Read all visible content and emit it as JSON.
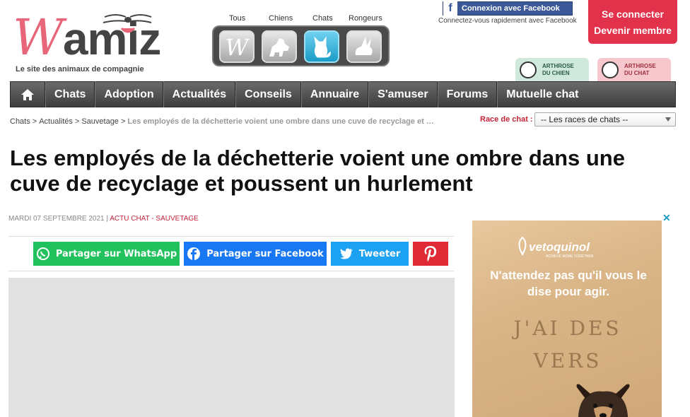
{
  "header": {
    "logo_first": "W",
    "logo_rest": "amiz",
    "tagline": "Le site des animaux de compagnie",
    "species": [
      {
        "label": "Tous",
        "icon": "w-logo-icon"
      },
      {
        "label": "Chiens",
        "icon": "dog-icon"
      },
      {
        "label": "Chats",
        "icon": "cat-icon",
        "active": true
      },
      {
        "label": "Rongeurs",
        "icon": "rabbit-icon"
      }
    ],
    "facebook_connect": "Connexion avec Facebook",
    "facebook_sub": "Connectez-vous rapidement avec Facebook",
    "login": "Se connecter",
    "signup": "Devenir membre",
    "arthrose_dog": [
      "ARTHROSE",
      "DU CHIEN"
    ],
    "arthrose_cat": [
      "ARTHROSE",
      "DU CHAT"
    ]
  },
  "nav": {
    "items": [
      "Chats",
      "Adoption",
      "Actualités",
      "Conseils",
      "Annuaire",
      "S'amuser",
      "Forums",
      "Mutuelle chat"
    ]
  },
  "breadcrumb": {
    "items": [
      "Chats",
      "Actualités",
      "Sauvetage"
    ],
    "current": "Les employés de la déchetterie voient une ombre dans une cuve de recyclage et …"
  },
  "race": {
    "label": "Race de chat :",
    "selected": "-- Les races de chats --"
  },
  "article": {
    "title": "Les employés de la déchetterie voient une ombre dans une cuve de recyclage et poussent un hurlement",
    "date": "MARDI 07 SEPTEMBRE 2021",
    "meta_sep": "|",
    "category": "ACTU CHAT - SAUVETAGE"
  },
  "share": {
    "whatsapp": "Partager sur WhatsApp",
    "facebook": "Partager sur Facebook",
    "twitter": "Tweeter"
  },
  "ad": {
    "brand": "vetoquinol",
    "brand_sub": "ACHIEVE MORE TOGETHER",
    "headline": "N'attendez pas qu'il vous le dise pour agir.",
    "sand_line1": "J'AI DES",
    "sand_line2": "VERS",
    "close": "✕"
  },
  "colors": {
    "accent": "#e2314a",
    "nav_bg": "#4a4a4a",
    "whatsapp": "#21c25d",
    "facebook": "#1877f2",
    "twitter": "#1da1f2",
    "pinterest": "#e02a36"
  }
}
